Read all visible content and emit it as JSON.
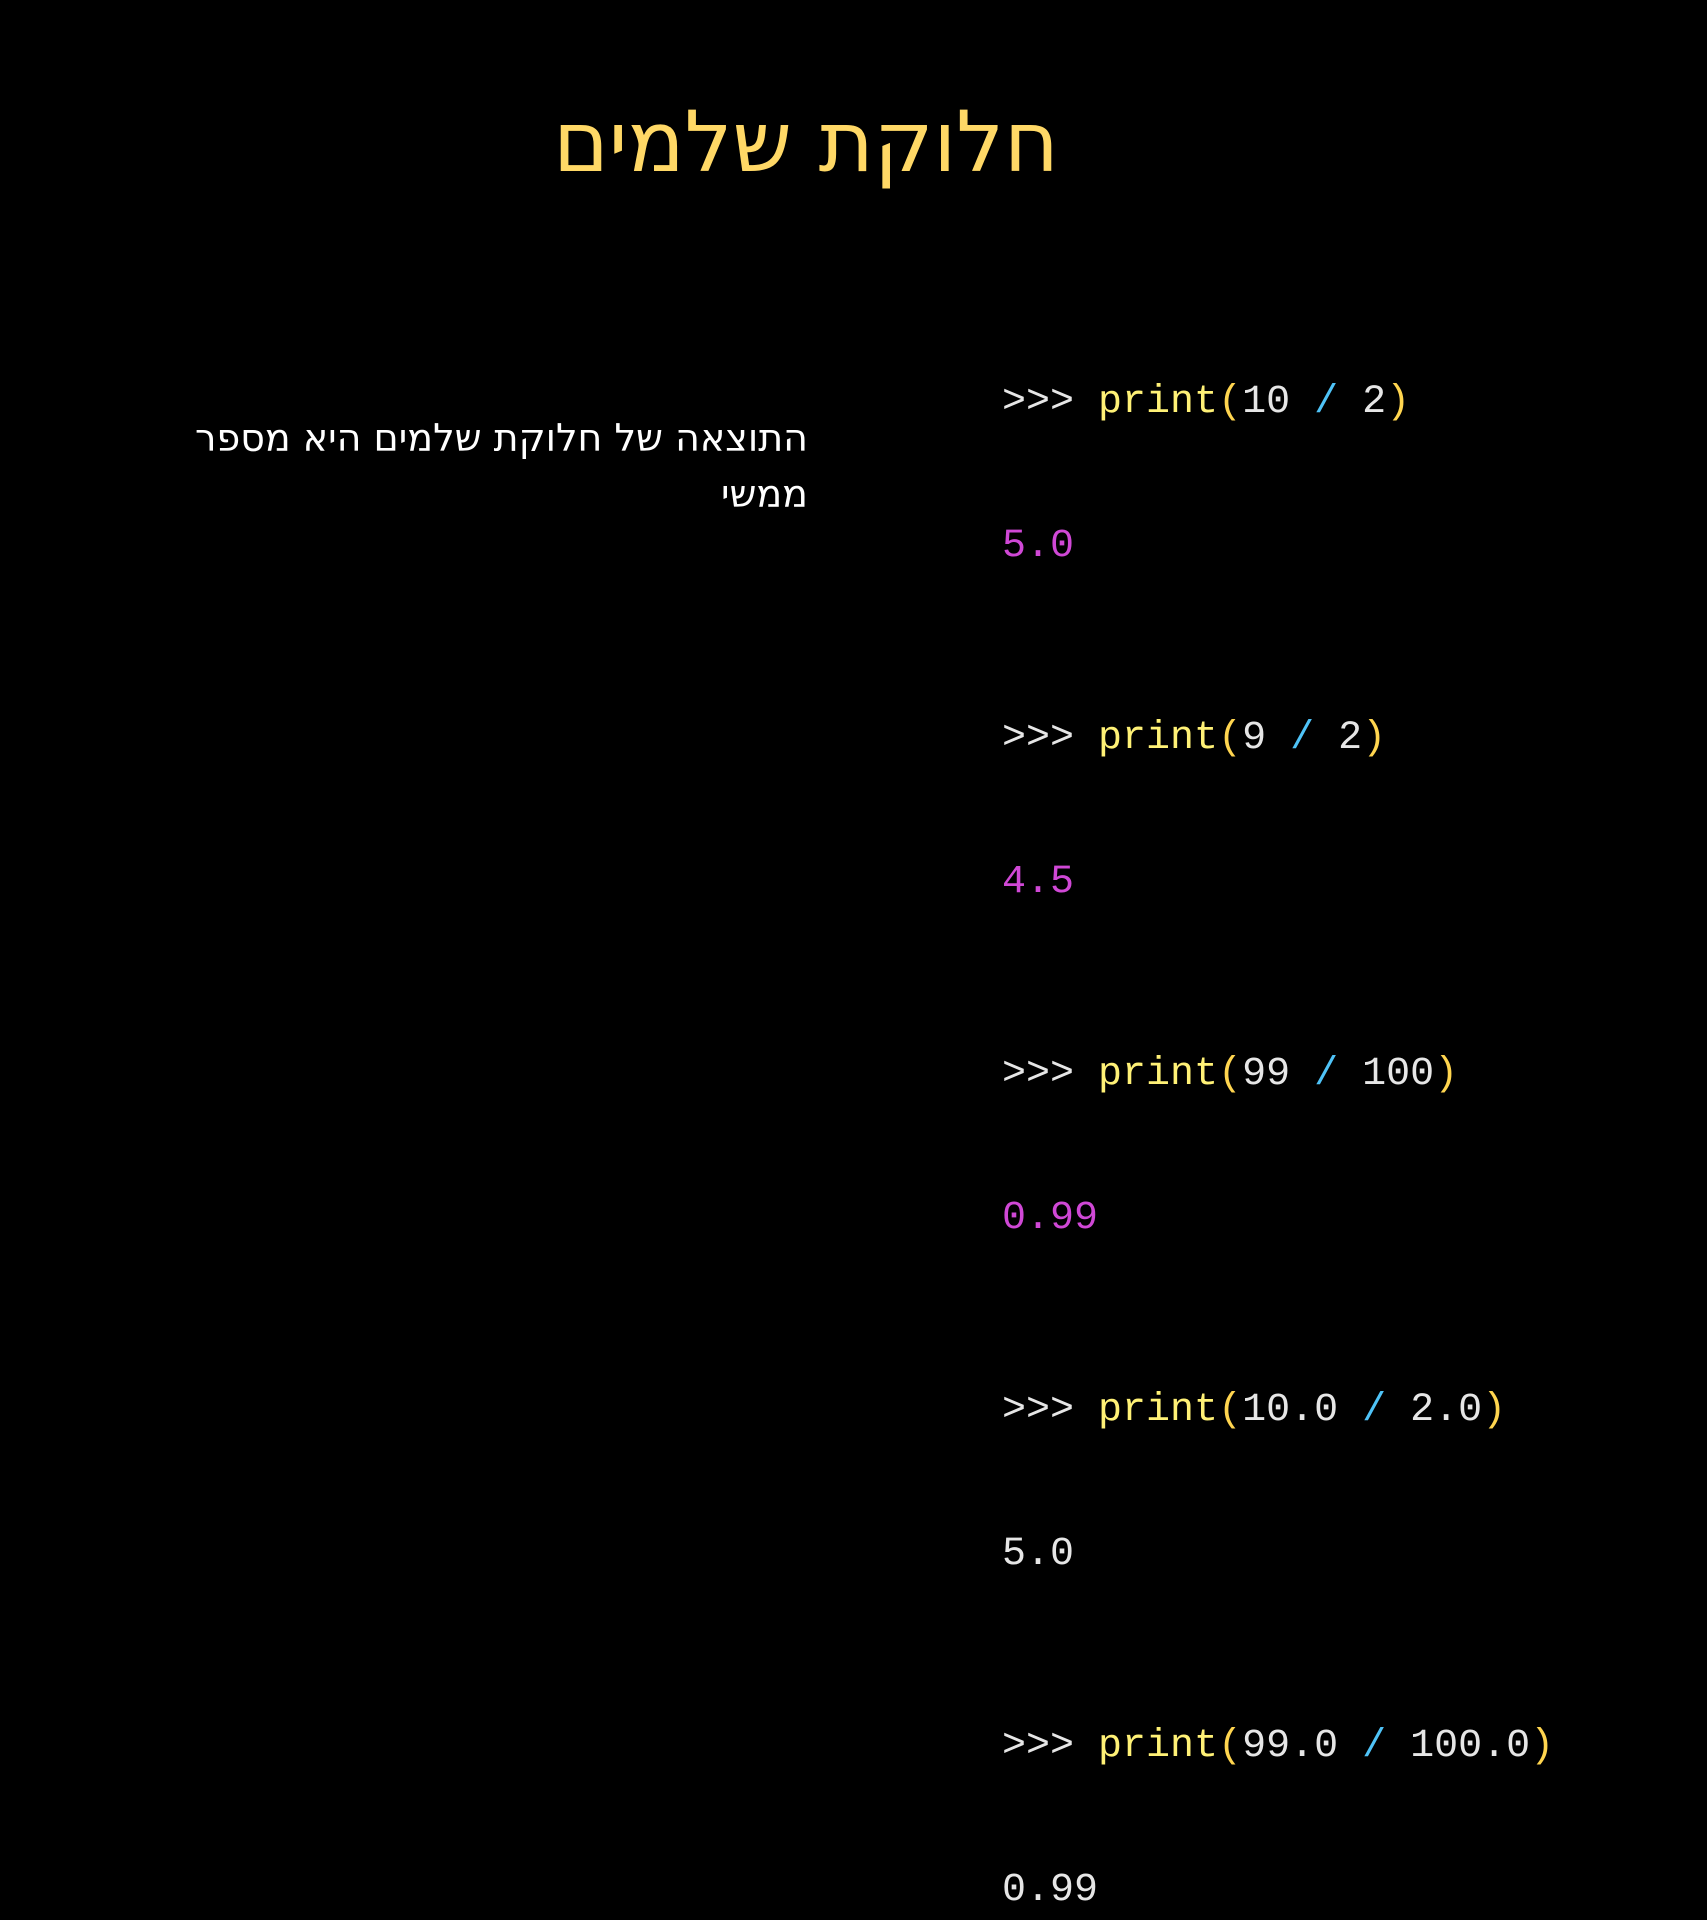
{
  "title": "חלוקת שלמים",
  "description": {
    "line1": "התוצאה של חלוקת שלמים היא מספר",
    "line2": "ממשי"
  },
  "colors": {
    "background": "#000000",
    "title": "#ffd866",
    "function": "#fff176",
    "paren": "#ffd54f",
    "operator": "#4fc3f7",
    "output_highlight": "#d048d6",
    "text": "#e6e6e6"
  },
  "code": {
    "lines": [
      {
        "prompt": ">>> ",
        "fn": "print",
        "open": "(",
        "a": "10",
        "op": " / ",
        "b": "2",
        "close": ")"
      },
      {
        "output": "5.0"
      },
      {
        "prompt": ">>> ",
        "fn": "print",
        "open": "(",
        "a": "9",
        "op": " / ",
        "b": "2",
        "close": ")"
      },
      {
        "output": "4.5"
      },
      {
        "prompt": ">>> ",
        "fn": "print",
        "open": "(",
        "a": "99",
        "op": " / ",
        "b": "100",
        "close": ")"
      },
      {
        "output": "0.99"
      },
      {
        "prompt": ">>> ",
        "fn": "print",
        "open": "(",
        "a": "10.0",
        "op": " / ",
        "b": "2.0",
        "close": ")"
      },
      {
        "output": "5.0"
      },
      {
        "prompt": ">>> ",
        "fn": "print",
        "open": "(",
        "a": "99.0",
        "op": " / ",
        "b": "100.0",
        "close": ")"
      },
      {
        "output": "0.99"
      }
    ]
  }
}
